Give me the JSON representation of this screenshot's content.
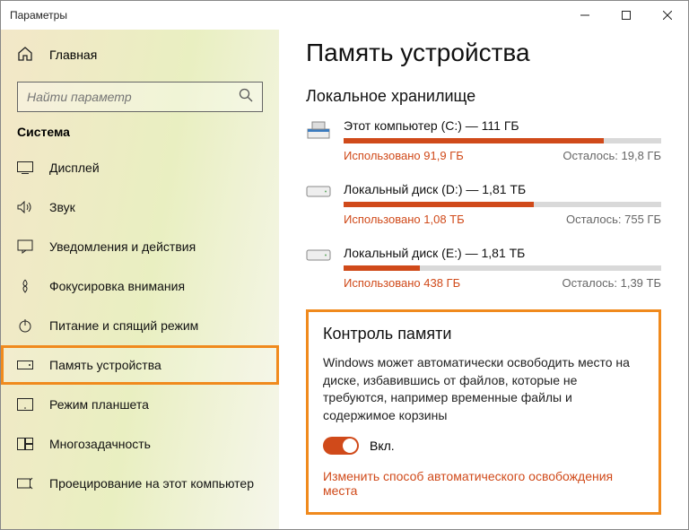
{
  "window": {
    "title": "Параметры"
  },
  "sidebar": {
    "home": "Главная",
    "search_placeholder": "Найти параметр",
    "section": "Система",
    "items": [
      {
        "label": "Дисплей"
      },
      {
        "label": "Звук"
      },
      {
        "label": "Уведомления и действия"
      },
      {
        "label": "Фокусировка внимания"
      },
      {
        "label": "Питание и спящий режим"
      },
      {
        "label": "Память устройства"
      },
      {
        "label": "Режим планшета"
      },
      {
        "label": "Многозадачность"
      },
      {
        "label": "Проецирование на этот компьютер"
      }
    ]
  },
  "main": {
    "title": "Память устройства",
    "local_storage": "Локальное хранилище",
    "drives": [
      {
        "name": "Этот компьютер (C:) — 111 ГБ",
        "used": "Использовано 91,9 ГБ",
        "free": "Осталось: 19,8 ГБ",
        "pct": 82
      },
      {
        "name": "Локальный диск (D:) — 1,81 ТБ",
        "used": "Использовано 1,08 ТБ",
        "free": "Осталось: 755 ГБ",
        "pct": 60
      },
      {
        "name": "Локальный диск (E:) — 1,81 ТБ",
        "used": "Использовано 438 ГБ",
        "free": "Осталось: 1,39 ТБ",
        "pct": 24
      }
    ],
    "control": {
      "title": "Контроль памяти",
      "desc": "Windows может автоматически освободить место на диске, избавившись от файлов, которые не требуются, например временные файлы и содержимое корзины",
      "toggle_label": "Вкл.",
      "link": "Изменить способ автоматического освобождения места"
    }
  }
}
